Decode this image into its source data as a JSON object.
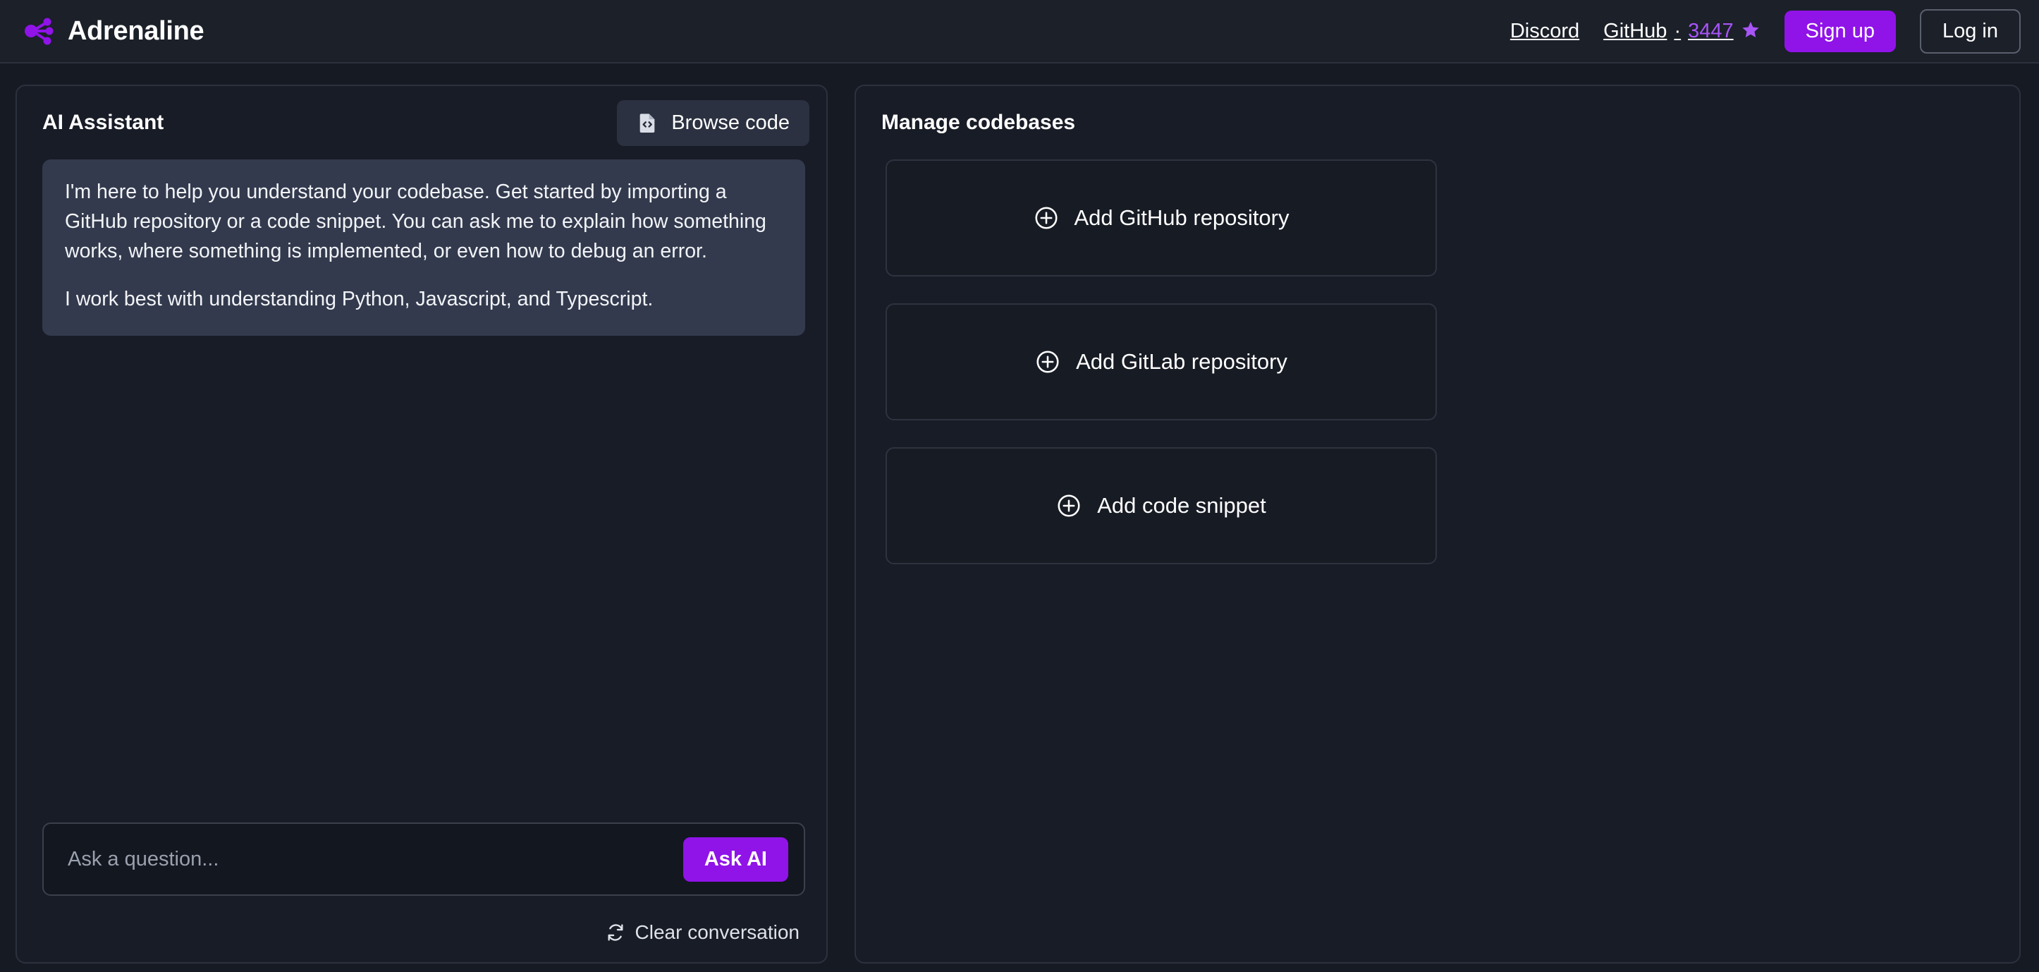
{
  "header": {
    "brand": {
      "name": "Adrenaline",
      "logo_icon": "network-node-icon",
      "accent": "#9013e8"
    },
    "nav": {
      "discord_label": "Discord",
      "github_label": "GitHub",
      "github_separator": "·",
      "github_stars": "3447",
      "star_icon": "star-icon",
      "signup_label": "Sign up",
      "login_label": "Log in"
    }
  },
  "assistant_panel": {
    "title": "AI Assistant",
    "browse_code": {
      "label": "Browse code",
      "icon": "file-code-icon"
    },
    "messages": [
      {
        "role": "assistant",
        "paragraphs": [
          "I'm here to help you understand your codebase. Get started by importing a GitHub repository or a code snippet. You can ask me to explain how something works, where something is implemented, or even how to debug an error.",
          "I work best with understanding Python, Javascript, and Typescript."
        ]
      }
    ],
    "composer": {
      "placeholder": "Ask a question...",
      "value": "",
      "submit_label": "Ask AI"
    },
    "clear_conversation": {
      "label": "Clear conversation",
      "icon": "reset-icon"
    }
  },
  "codebases_panel": {
    "title": "Manage codebases",
    "cards": [
      {
        "label": "Add GitHub repository",
        "icon": "plus-circle-icon"
      },
      {
        "label": "Add GitLab repository",
        "icon": "plus-circle-icon"
      },
      {
        "label": "Add code snippet",
        "icon": "plus-circle-icon"
      }
    ]
  },
  "colors": {
    "page_background": "#161a23",
    "panel_background": "#181c26",
    "panel_border": "#2b313d",
    "accent_purple": "#9013e8",
    "star_purple": "#a855f7",
    "bubble_background": "#333a4d"
  }
}
